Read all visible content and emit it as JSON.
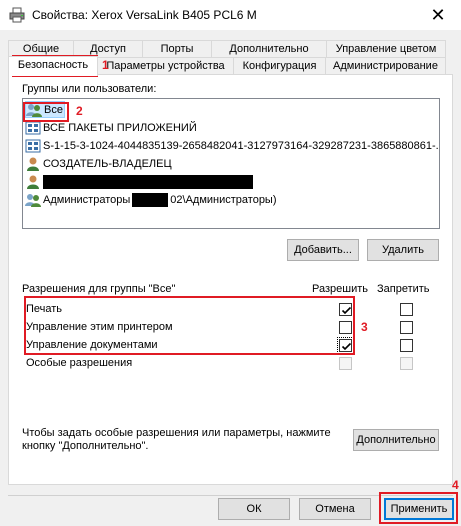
{
  "window": {
    "title": "Свойства: Xerox VersaLink B405 PCL6 M",
    "close_glyph": "✕"
  },
  "tabs_top": [
    {
      "label": "Общие"
    },
    {
      "label": "Доступ"
    },
    {
      "label": "Порты"
    },
    {
      "label": "Дополнительно"
    },
    {
      "label": "Управление цветом"
    }
  ],
  "tabs_bottom": [
    {
      "label": "Безопасность",
      "active": true
    },
    {
      "label": "Параметры устройства"
    },
    {
      "label": "Конфигурация"
    },
    {
      "label": "Администрирование"
    }
  ],
  "groups": {
    "label": "Группы или пользователи:",
    "items": [
      {
        "text": "Все",
        "icon": "users-icon",
        "selected": true
      },
      {
        "text": "ВСЕ ПАКЕТЫ ПРИЛОЖЕНИЙ",
        "icon": "app-packages-icon"
      },
      {
        "text": "S-1-15-3-1024-4044835139-2658482041-3127973164-329287231-3865880861-...",
        "icon": "sid-icon"
      },
      {
        "text": "СОЗДАТЕЛЬ-ВЛАДЕЛЕЦ",
        "icon": "user-icon"
      },
      {
        "text": "",
        "icon": "user-icon",
        "redacted": true
      },
      {
        "text_before": "Администраторы",
        "text_after": "02\\Администраторы)",
        "icon": "users-icon"
      }
    ],
    "add_button": "Добавить...",
    "remove_button": "Удалить"
  },
  "permissions": {
    "header": "Разрешения для группы \"Все\"",
    "allow_header": "Разрешить",
    "deny_header": "Запретить",
    "rows": [
      {
        "label": "Печать",
        "allow": true,
        "deny": false,
        "disabled": false
      },
      {
        "label": "Управление этим принтером",
        "allow": false,
        "deny": false,
        "disabled": false
      },
      {
        "label": "Управление документами",
        "allow": true,
        "deny": false,
        "disabled": false
      },
      {
        "label": "Особые разрешения",
        "allow": false,
        "deny": false,
        "disabled": true
      }
    ]
  },
  "advanced": {
    "hint": "Чтобы задать особые разрешения или параметры, нажмите кнопку \"Дополнительно\".",
    "button": "Дополнительно"
  },
  "footer": {
    "ok": "ОК",
    "cancel": "Отмена",
    "apply": "Применить"
  },
  "annotations": {
    "n1": "1",
    "n2": "2",
    "n3": "3",
    "n4": "4",
    "color": "#e01b24"
  }
}
